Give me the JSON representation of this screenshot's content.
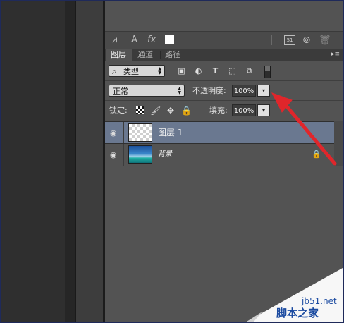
{
  "toolbar": {
    "s1_label": "S1"
  },
  "tabs": [
    {
      "label": "图层",
      "active": true
    },
    {
      "label": "通道",
      "active": false
    },
    {
      "label": "路径",
      "active": false
    }
  ],
  "filter": {
    "kind_label": "类型"
  },
  "blend": {
    "mode": "正常",
    "opacity_label": "不透明度:",
    "opacity_value": "100%"
  },
  "lock": {
    "label": "锁定:",
    "fill_label": "填充:",
    "fill_value": "100%"
  },
  "layers": [
    {
      "name": "图层 1",
      "selected": true,
      "visible": true,
      "thumbnail": "transparent-checker"
    },
    {
      "name": "背景",
      "selected": false,
      "visible": true,
      "locked": true,
      "thumbnail": "ocean-scene"
    }
  ],
  "annotation": {
    "arrow_color": "#e0262b"
  },
  "watermark": {
    "site": "jb51.net",
    "brand": "脚本之家"
  },
  "colors": {
    "panel_bg": "#535353",
    "selected_layer_bg": "#6a7890",
    "frame_border": "#1f2a5a"
  }
}
